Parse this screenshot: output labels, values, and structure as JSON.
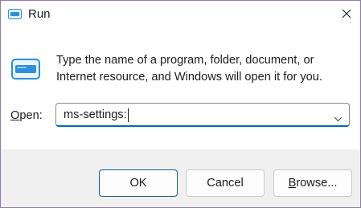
{
  "window": {
    "title": "Run",
    "title_icon": "run-icon",
    "close_icon": "close-icon"
  },
  "dialog": {
    "icon": "run-icon",
    "description": "Type the name of a program, folder, document, or Internet resource, and Windows will open it for you.",
    "open_label_prefix": "O",
    "open_label_rest": "pen:",
    "open_value": "ms-settings:",
    "dropdown_icon": "chevron-down-icon"
  },
  "buttons": {
    "ok": "OK",
    "cancel": "Cancel",
    "browse_prefix": "B",
    "browse_rest": "rowse..."
  },
  "colors": {
    "accent": "#0067c0",
    "icon_blue": "#2f8fd8",
    "footer": "#f0f0f0"
  }
}
